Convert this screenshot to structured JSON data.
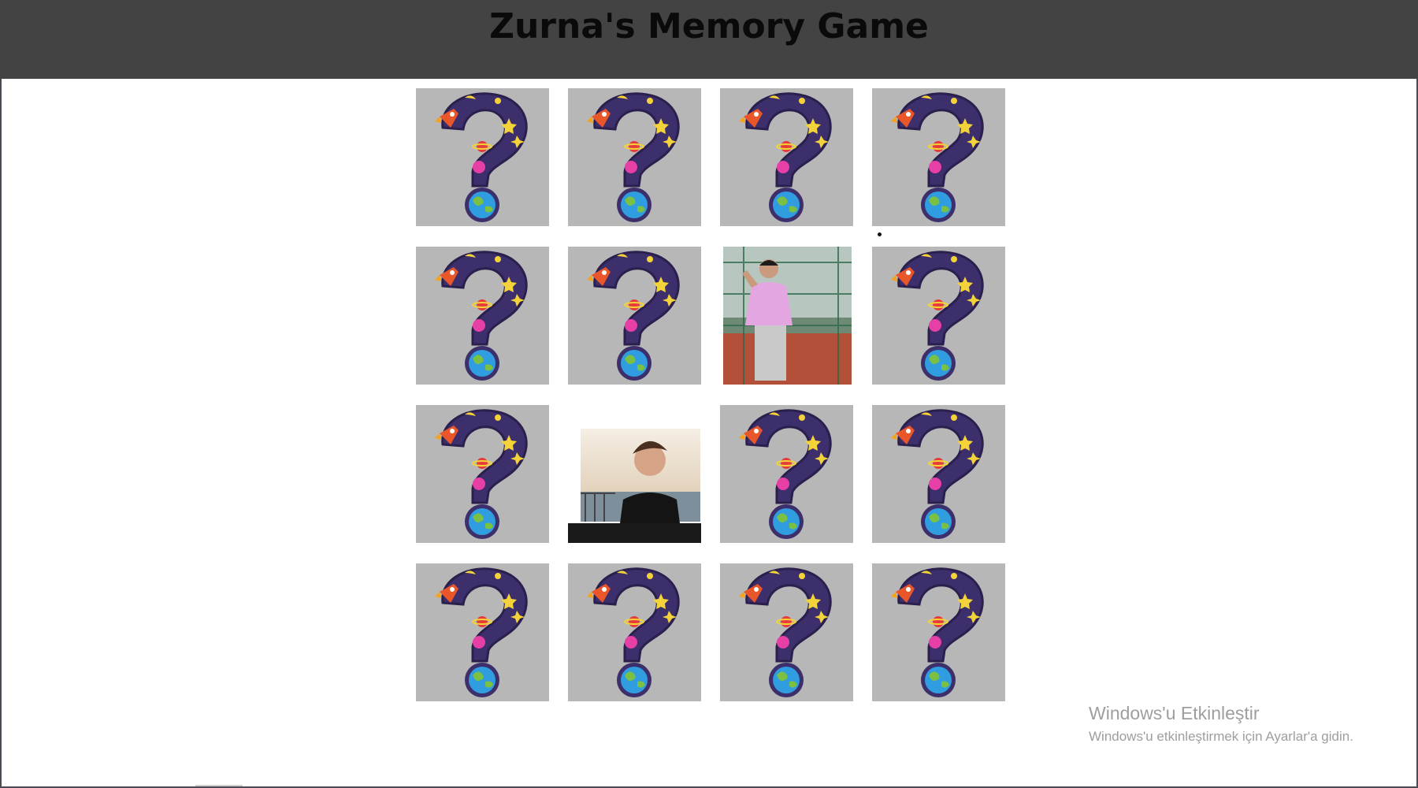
{
  "header": {
    "title": "Zurna's Memory Game"
  },
  "board": {
    "rows": 4,
    "cols": 4,
    "cards": [
      {
        "state": "hidden"
      },
      {
        "state": "hidden"
      },
      {
        "state": "hidden"
      },
      {
        "state": "hidden"
      },
      {
        "state": "hidden"
      },
      {
        "state": "hidden"
      },
      {
        "state": "revealed",
        "face": "photo-person-pink-shirt"
      },
      {
        "state": "hidden"
      },
      {
        "state": "hidden"
      },
      {
        "state": "revealed",
        "face": "photo-person-sunset-selfie"
      },
      {
        "state": "hidden"
      },
      {
        "state": "hidden"
      },
      {
        "state": "hidden"
      },
      {
        "state": "hidden"
      },
      {
        "state": "hidden"
      },
      {
        "state": "hidden"
      }
    ],
    "card_back_icon": "space-question-mark-icon"
  },
  "colors": {
    "header_bg": "#434343",
    "card_back_bg": "#b7b7b7",
    "question_mark": "#3d2f6b"
  },
  "watermark": {
    "line1": "Windows'u Etkinleştir",
    "line2": "Windows'u etkinleştirmek için Ayarlar'a gidin."
  }
}
